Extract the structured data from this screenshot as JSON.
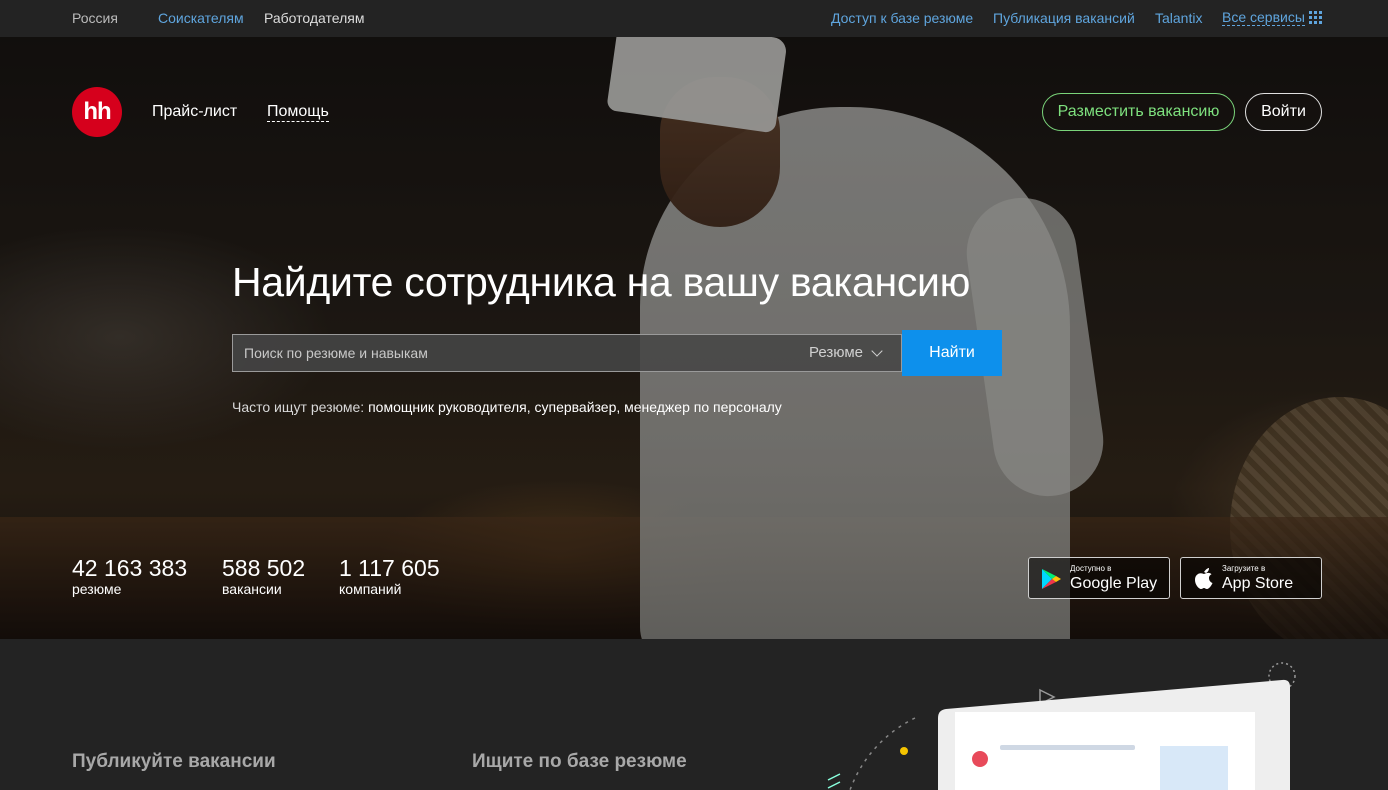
{
  "topbar": {
    "region": "Россия",
    "seekers": "Соискателям",
    "employers": "Работодателям",
    "resume_access": "Доступ к базе резюме",
    "vacancy_publish": "Публикация вакансий",
    "talantix": "Talantix",
    "all_services": "Все сервисы"
  },
  "header": {
    "logo_text": "hh",
    "price_list": "Прайс-лист",
    "help": "Помощь",
    "post_vacancy": "Разместить вакансию",
    "login": "Войти"
  },
  "hero": {
    "title": "Найдите сотрудника на вашу вакансию",
    "search_placeholder": "Поиск по резюме и навыкам",
    "search_type": "Резюме",
    "find_button": "Найти",
    "popular_prefix": "Часто ищут резюме:",
    "popular_queries": "помощник руководителя, супервайзер, менеджер по персоналу"
  },
  "stats": [
    {
      "value": "42 163 383",
      "label": "резюме"
    },
    {
      "value": "588 502",
      "label": "вакансии"
    },
    {
      "value": "1 117 605",
      "label": "компаний"
    }
  ],
  "stores": {
    "google_small": "Доступно в",
    "google_big": "Google Play",
    "apple_small": "Загрузите в",
    "apple_big": "App Store"
  },
  "sections": {
    "publish": "Публикуйте вакансии",
    "search_db": "Ищите по базе резюме"
  },
  "colors": {
    "brand_red": "#d6001c",
    "link_blue": "#5fa5de",
    "find_button": "#0d90ec",
    "post_button_green": "#7ee07e"
  }
}
